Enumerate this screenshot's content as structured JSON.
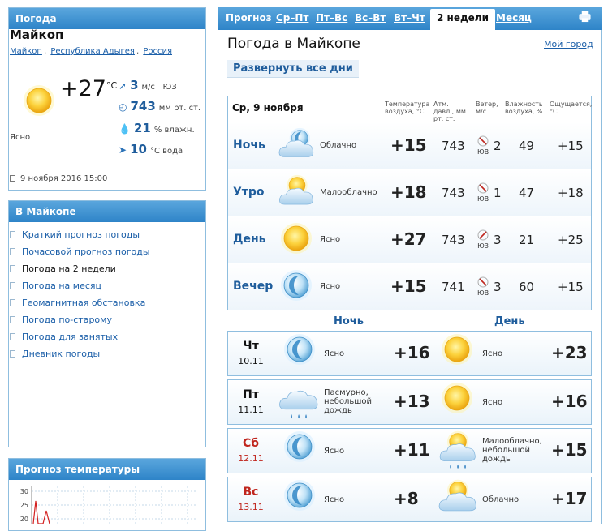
{
  "left": {
    "weather_panel": {
      "title": "Погода",
      "city": "Майкоп",
      "breadcrumbs": [
        "Майкоп",
        "Республика Адыгея",
        "Россия"
      ],
      "temp": "+27",
      "temp_unit": "°C",
      "condition": "Ясно",
      "wind_value": "3",
      "wind_unit": "м/с",
      "wind_dir": "ЮЗ",
      "pressure_value": "743",
      "pressure_unit": "мм рт. ст.",
      "humidity_value": "21",
      "humidity_unit": "% влажн.",
      "water_value": "10",
      "water_unit": "°С вода",
      "datetime": "9 ноября 2016 15:00"
    },
    "city_menu": {
      "title": "В Майкопе",
      "items": [
        "Краткий прогноз погоды",
        "Почасовой прогноз погоды",
        "Погода на 2 недели",
        "Погода на месяц",
        "Геомагнитная обстановка",
        "Погода по-старому",
        "Погода для занятых",
        "Дневник погоды"
      ],
      "current_index": 2
    },
    "temp_chart": {
      "title": "Прогноз температуры",
      "y_ticks": [
        "30",
        "25",
        "20"
      ]
    }
  },
  "tabs": {
    "items": [
      "Прогноз",
      "Ср–Пт",
      "Пт–Вс",
      "Вс–Вт",
      "Вт–Чт",
      "2 недели",
      "Месяц"
    ],
    "active": "2 недели"
  },
  "main": {
    "title": "Погода в Майкопе",
    "my_city": "Мой город",
    "expand": "Развернуть все дни",
    "day_header": "Ср, 9 ноября",
    "columns": [
      "Температура воздуха, °С",
      "Атм. давл., мм рт. ст.",
      "Ветер, м/с",
      "Влажность воздуха, %",
      "Ощущается, °С"
    ],
    "day_rows": [
      {
        "label": "Ночь",
        "icon": "cloudy-moon-icon",
        "cond": "Облачно",
        "temp": "+15",
        "pressure": "743",
        "wind_dir": "ЮВ",
        "wind": "2",
        "humidity": "49",
        "feels": "+15"
      },
      {
        "label": "Утро",
        "icon": "sun-cloud-icon",
        "cond": "Малооблачно",
        "temp": "+18",
        "pressure": "743",
        "wind_dir": "ЮВ",
        "wind": "1",
        "humidity": "47",
        "feels": "+18"
      },
      {
        "label": "День",
        "icon": "sun-icon",
        "cond": "Ясно",
        "temp": "+27",
        "pressure": "743",
        "wind_dir": "ЮЗ",
        "wind": "3",
        "humidity": "21",
        "feels": "+25"
      },
      {
        "label": "Вечер",
        "icon": "moon-icon",
        "cond": "Ясно",
        "temp": "+15",
        "pressure": "741",
        "wind_dir": "ЮВ",
        "wind": "3",
        "humidity": "60",
        "feels": "+15"
      }
    ],
    "forecast_headers": {
      "night": "Ночь",
      "day": "День"
    },
    "forecast": [
      {
        "dow": "Чт",
        "date": "10.11",
        "weekend": false,
        "night_icon": "moon-icon",
        "night_cond": "Ясно",
        "night_temp": "+16",
        "day_icon": "sun-icon",
        "day_cond": "Ясно",
        "day_temp": "+23"
      },
      {
        "dow": "Пт",
        "date": "11.11",
        "weekend": false,
        "night_icon": "rain-cloud-icon",
        "night_cond": "Пасмурно, небольшой дождь",
        "night_temp": "+13",
        "day_icon": "sun-icon",
        "day_cond": "Ясно",
        "day_temp": "+16"
      },
      {
        "dow": "Сб",
        "date": "12.11",
        "weekend": true,
        "night_icon": "moon-icon",
        "night_cond": "Ясно",
        "night_temp": "+11",
        "day_icon": "sun-cloud-rain-icon",
        "day_cond": "Малооблачно, небольшой дождь",
        "day_temp": "+15"
      },
      {
        "dow": "Вс",
        "date": "13.11",
        "weekend": true,
        "night_icon": "moon-icon",
        "night_cond": "Ясно",
        "night_temp": "+8",
        "day_icon": "sun-cloud-icon",
        "day_cond": "Облачно",
        "day_temp": "+17"
      }
    ]
  }
}
